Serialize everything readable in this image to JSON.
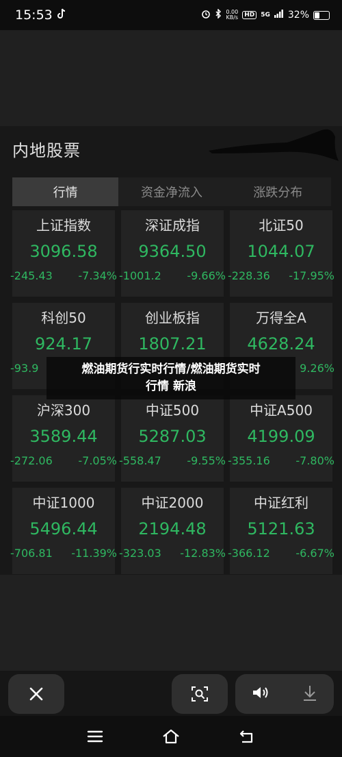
{
  "status_bar": {
    "time": "15:53",
    "net_speed_value": "0.00",
    "net_speed_unit": "KB/s",
    "hd": "HD",
    "signal": "5G",
    "battery": "32%",
    "battery_level": 0.32
  },
  "panel": {
    "title": "内地股票",
    "tabs": [
      {
        "label": "行情",
        "active": true
      },
      {
        "label": "资金净流入",
        "active": false
      },
      {
        "label": "涨跌分布",
        "active": false
      }
    ]
  },
  "indices": [
    {
      "name": "上证指数",
      "value": "3096.58",
      "change": "-245.43",
      "pct": "-7.34%"
    },
    {
      "name": "深证成指",
      "value": "9364.50",
      "change": "-1001.2",
      "pct": "-9.66%"
    },
    {
      "name": "北证50",
      "value": "1044.07",
      "change": "-228.36",
      "pct": "-17.95%"
    },
    {
      "name": "科创50",
      "value": "924.17",
      "change": "-93.9",
      "pct": ""
    },
    {
      "name": "创业板指",
      "value": "1807.21",
      "change": "",
      "pct": ""
    },
    {
      "name": "万得全A",
      "value": "4628.24",
      "change": "",
      "pct": "9.26%"
    },
    {
      "name": "沪深300",
      "value": "3589.44",
      "change": "-272.06",
      "pct": "-7.05%"
    },
    {
      "name": "中证500",
      "value": "5287.03",
      "change": "-558.47",
      "pct": "-9.55%"
    },
    {
      "name": "中证A500",
      "value": "4199.09",
      "change": "-355.16",
      "pct": "-7.80%"
    },
    {
      "name": "中证1000",
      "value": "5496.44",
      "change": "-706.81",
      "pct": "-11.39%"
    },
    {
      "name": "中证2000",
      "value": "2194.48",
      "change": "-323.03",
      "pct": "-12.83%"
    },
    {
      "name": "中证红利",
      "value": "5121.63",
      "change": "-366.12",
      "pct": "-6.67%"
    }
  ],
  "overlay": {
    "line1": "燃油期货行实时行情/燃油期货实时",
    "line2": "行情 新浪"
  },
  "colors": {
    "down": "#2fb861",
    "background": "#181818"
  },
  "toolbar_icons": [
    "close-icon",
    "scan-icon",
    "volume-icon",
    "download-icon"
  ],
  "nav_icons": [
    "menu-icon",
    "home-icon",
    "back-icon"
  ]
}
